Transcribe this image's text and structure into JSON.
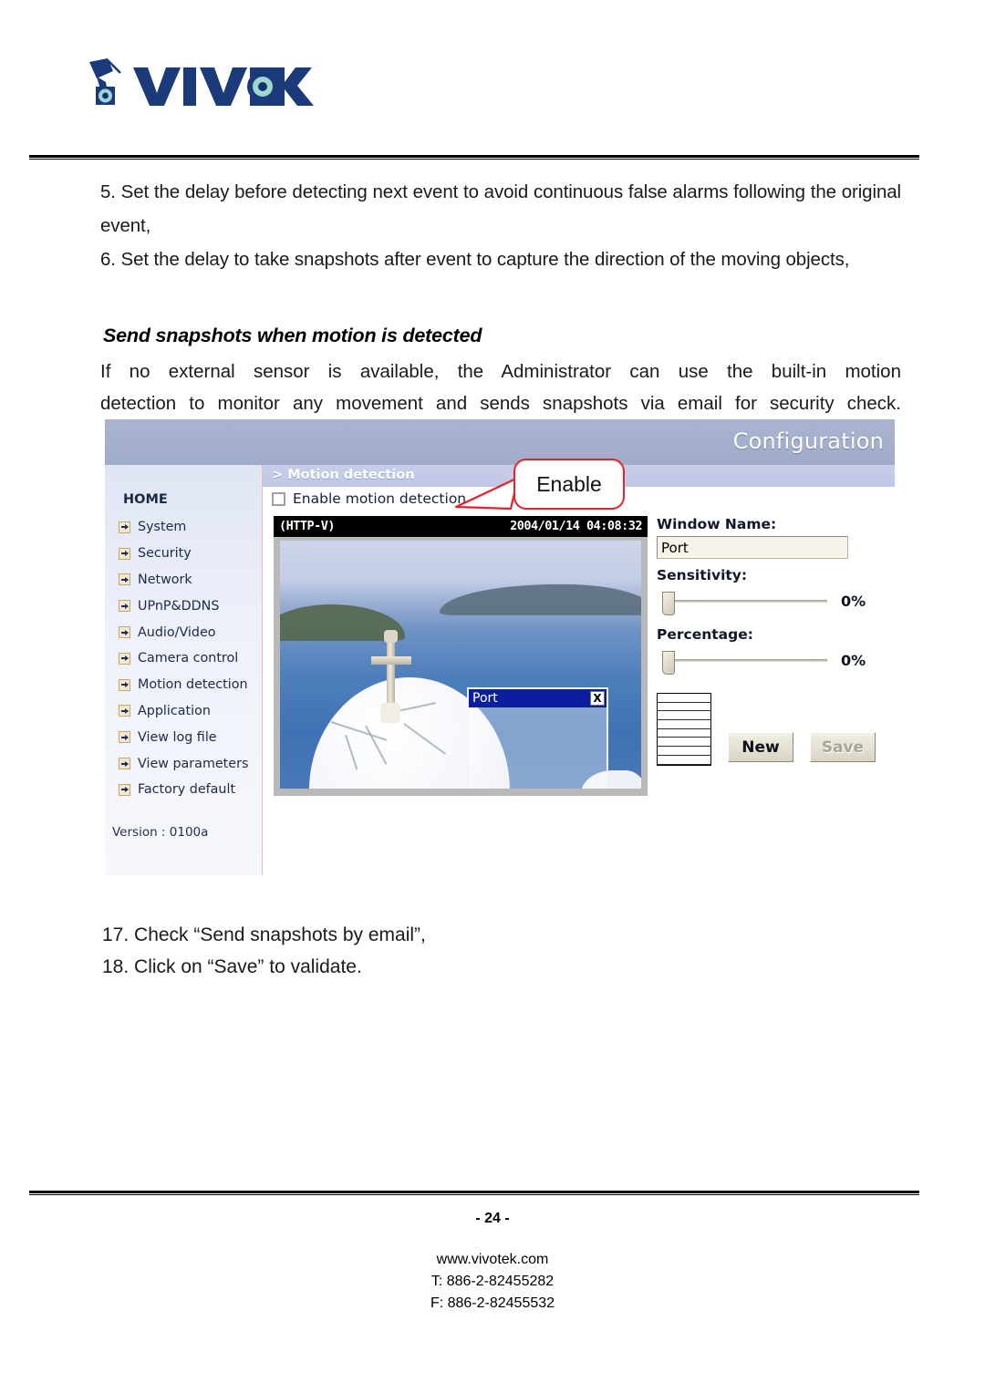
{
  "brand": {
    "logo_text": "VIVOTEK",
    "logo_name": "vivotek-logo"
  },
  "body": {
    "step5": "5. Set the delay before detecting next event to avoid continuous false alarms following the original event,",
    "step6": "6. Set the delay to take snapshots after event to capture the direction of the moving objects,",
    "section_heading": "Send snapshots when motion is detected",
    "intro_line1": "If no external sensor is available, the Administrator can use the built-in motion",
    "intro_line2": "detection to monitor any movement and sends snapshots via email for security check.",
    "step17": "17. Check “Send snapshots by email”,",
    "step18": "18. Click on “Save” to validate."
  },
  "screenshot": {
    "header_title": "Configuration",
    "sidebar": {
      "home_label": "HOME",
      "items": [
        {
          "label": "System",
          "icon": "arrow-right-icon"
        },
        {
          "label": "Security",
          "icon": "arrow-right-icon"
        },
        {
          "label": "Network",
          "icon": "arrow-right-icon"
        },
        {
          "label": "UPnP&DDNS",
          "icon": "arrow-right-icon"
        },
        {
          "label": "Audio/Video",
          "icon": "arrow-right-icon"
        },
        {
          "label": "Camera control",
          "icon": "arrow-right-icon"
        },
        {
          "label": "Motion detection",
          "icon": "arrow-right-icon"
        },
        {
          "label": "Application",
          "icon": "arrow-right-icon"
        },
        {
          "label": "View log file",
          "icon": "arrow-right-icon"
        },
        {
          "label": "View parameters",
          "icon": "arrow-right-icon"
        },
        {
          "label": "Factory default",
          "icon": "arrow-right-icon"
        }
      ],
      "version": "Version : 0100a"
    },
    "breadcrumb": "> Motion detection",
    "enable_checkbox_label": "Enable motion detection",
    "enable_checkbox_checked": false,
    "video": {
      "osd_left": "(HTTP-V)",
      "osd_right": "2004/01/14 04:08:32",
      "overlay_window": {
        "title": "Port",
        "close_label": "X"
      }
    },
    "panel": {
      "window_name_label": "Window Name:",
      "window_name_value": "Port",
      "sensitivity_label": "Sensitivity:",
      "sensitivity_value": "0%",
      "percentage_label": "Percentage:",
      "percentage_value": "0%",
      "new_button": "New",
      "save_button": "Save"
    },
    "callout": {
      "text": "Enable",
      "border_color": "#e8222a"
    }
  },
  "footer": {
    "page_number": "- 24 -",
    "website": "www.vivotek.com",
    "tel": "T: 886-2-82455282",
    "fax": "F: 886-2-82455532"
  }
}
